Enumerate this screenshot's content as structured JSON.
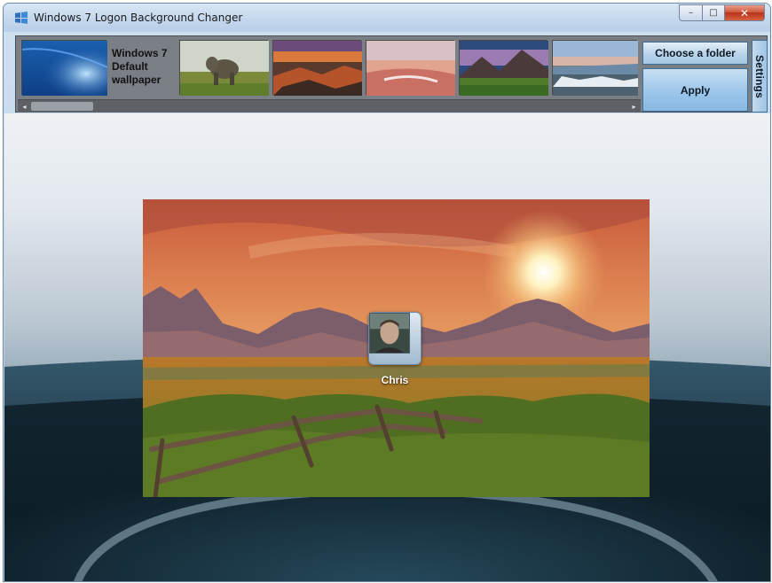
{
  "window": {
    "title": "Windows 7 Logon Background Changer",
    "controls": {
      "minimize": "–",
      "maximize": "□",
      "close": "✕"
    }
  },
  "toolbar": {
    "thumbnails": [
      {
        "name": "default-wallpaper",
        "label_lines": [
          "Windows 7",
          "Default",
          "wallpaper"
        ],
        "selected": false
      },
      {
        "name": "elephant"
      },
      {
        "name": "rocky-coast-sunset"
      },
      {
        "name": "pink-lake"
      },
      {
        "name": "mountain-meadow"
      },
      {
        "name": "waterfall-lake"
      }
    ],
    "choose_folder_label": "Choose a folder",
    "apply_label": "Apply",
    "settings_label": "Settings",
    "scroll": {
      "left_arrow": "◂",
      "right_arrow": "▸"
    }
  },
  "preview": {
    "user_name": "Chris"
  },
  "colors": {
    "title_bar": "#c3d6ec",
    "toolbar_bg": "#7a7f86",
    "button_blue": "#9cc6ea",
    "close_red": "#c8442a"
  }
}
